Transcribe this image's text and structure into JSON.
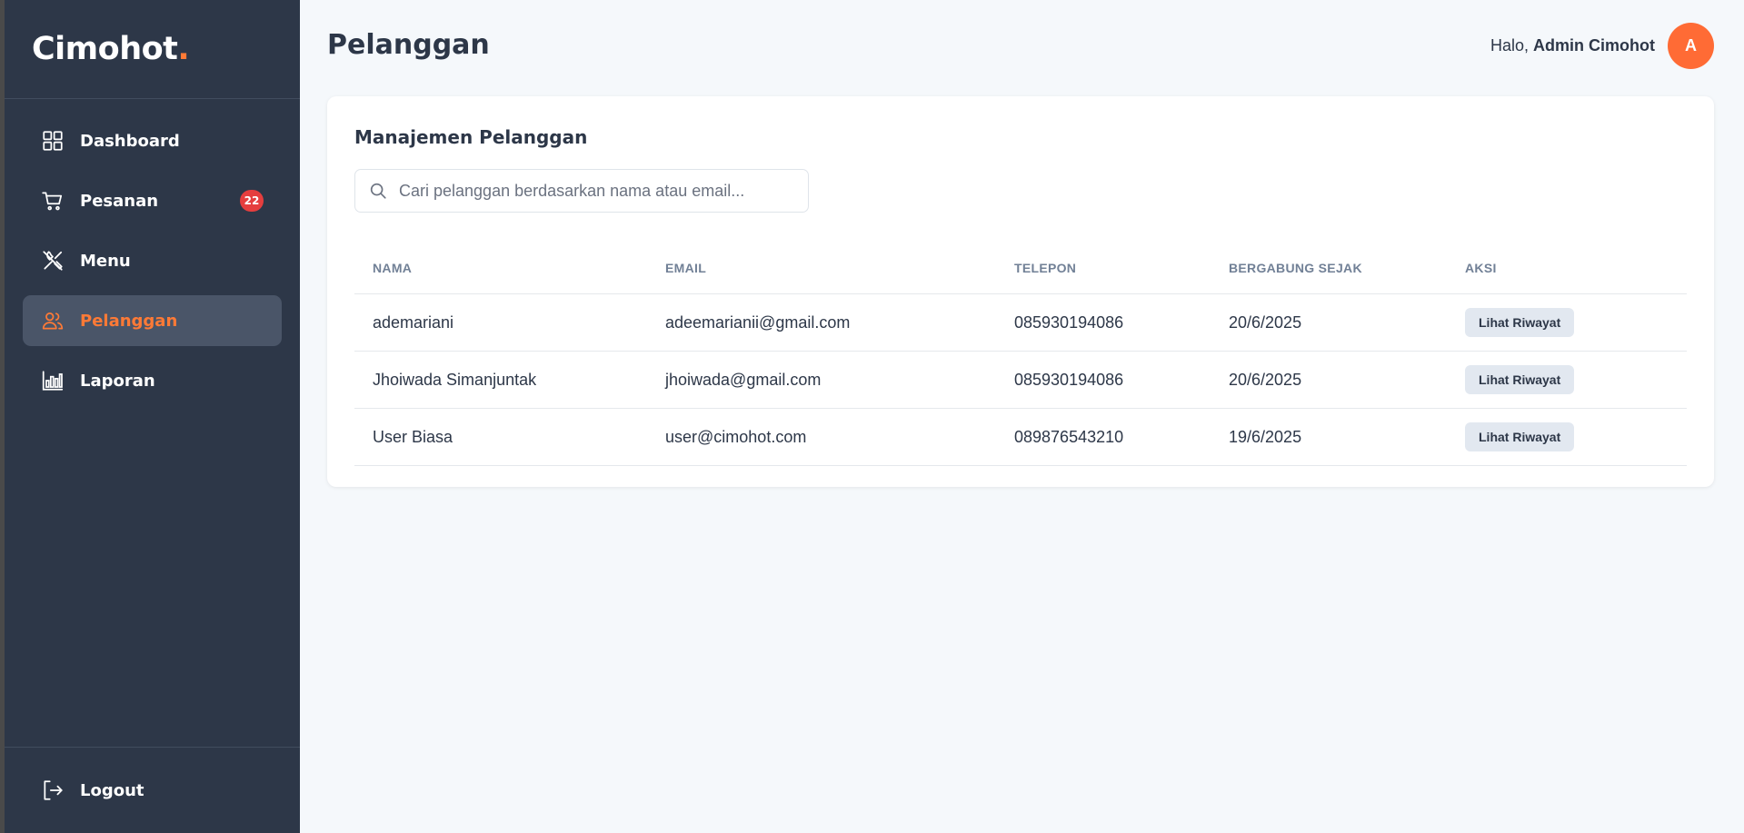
{
  "brand": {
    "name": "Cimohot",
    "dot": "."
  },
  "sidebar": {
    "items": [
      {
        "label": "Dashboard",
        "icon": "dashboard-grid-icon"
      },
      {
        "label": "Pesanan",
        "icon": "cart-icon",
        "badge": "22"
      },
      {
        "label": "Menu",
        "icon": "utensils-icon"
      },
      {
        "label": "Pelanggan",
        "icon": "users-icon",
        "active": true
      },
      {
        "label": "Laporan",
        "icon": "bar-chart-icon"
      }
    ],
    "logout": {
      "label": "Logout",
      "icon": "logout-icon"
    }
  },
  "header": {
    "title": "Pelanggan",
    "greeting": "Halo,",
    "user_name": "Admin Cimohot",
    "avatar_initial": "A"
  },
  "card": {
    "title": "Manajemen Pelanggan",
    "search_placeholder": "Cari pelanggan berdasarkan nama atau email..."
  },
  "table": {
    "columns": [
      "NAMA",
      "EMAIL",
      "TELEPON",
      "BERGABUNG SEJAK",
      "AKSI"
    ],
    "rows": [
      {
        "nama": "ademariani",
        "email": "adeemarianii@gmail.com",
        "telepon": "085930194086",
        "bergabung": "20/6/2025",
        "aksi": "Lihat Riwayat"
      },
      {
        "nama": "Jhoiwada Simanjuntak",
        "email": "jhoiwada@gmail.com",
        "telepon": "085930194086",
        "bergabung": "20/6/2025",
        "aksi": "Lihat Riwayat"
      },
      {
        "nama": "User Biasa",
        "email": "user@cimohot.com",
        "telepon": "089876543210",
        "bergabung": "19/6/2025",
        "aksi": "Lihat Riwayat"
      }
    ]
  },
  "colors": {
    "sidebar_bg": "#2d3748",
    "accent": "#ff7a36",
    "badge": "#e53e3e",
    "main_bg": "#f5f8fb"
  }
}
